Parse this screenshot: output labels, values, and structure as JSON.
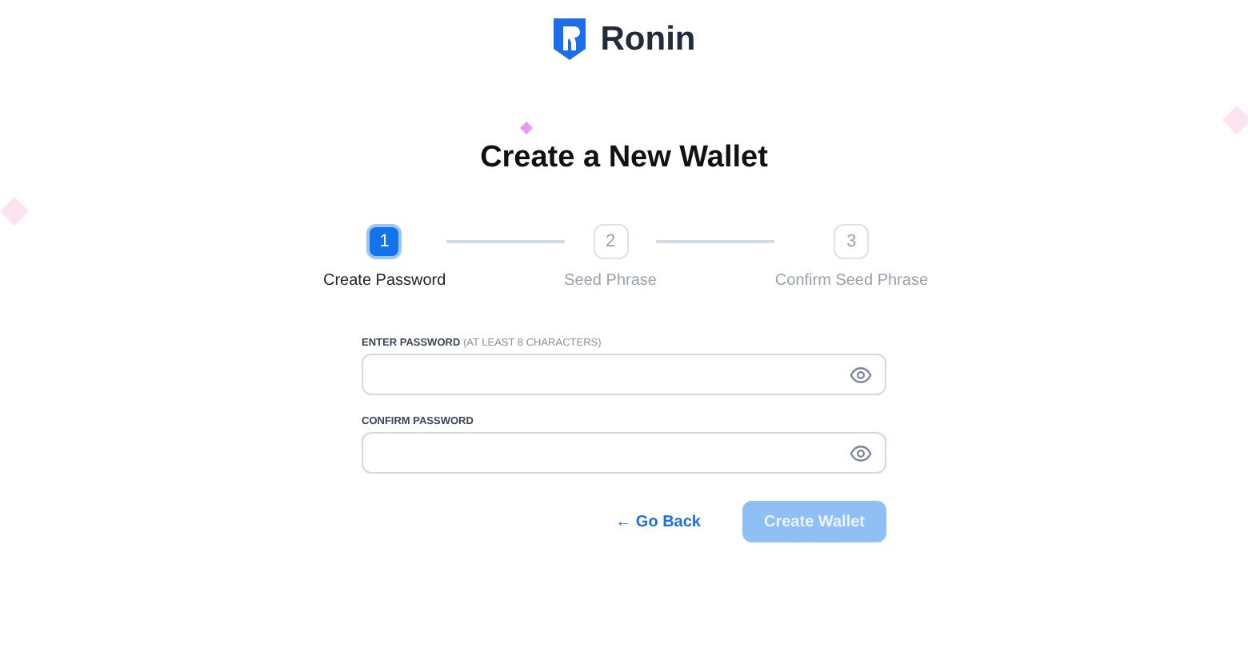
{
  "brand": {
    "name": "Ronin"
  },
  "title": "Create a New Wallet",
  "steps": [
    {
      "number": "1",
      "label": "Create Password",
      "selected": true
    },
    {
      "number": "2",
      "label": "Seed Phrase",
      "selected": false
    },
    {
      "number": "3",
      "label": "Confirm Seed Phrase",
      "selected": false
    }
  ],
  "fields": [
    {
      "label": "ENTER PASSWORD",
      "hint": "(AT LEAST 8 CHARACTERS)"
    },
    {
      "label": "CONFIRM PASSWORD"
    }
  ],
  "buttons": {
    "back": "← Go Back",
    "create": {
      "label": "Create Wallet",
      "disabled": true
    }
  }
}
